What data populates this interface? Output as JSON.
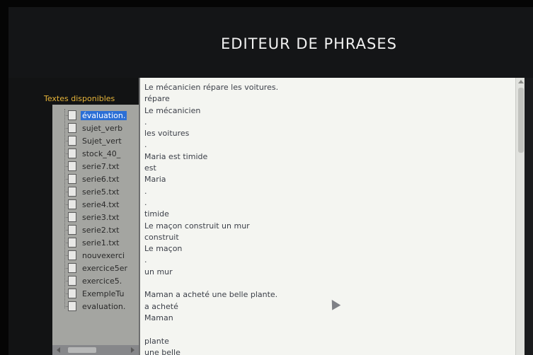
{
  "app": {
    "title": "EDITEUR DE PHRASES"
  },
  "sidebar": {
    "label": "Textes disponibles",
    "items": [
      {
        "label": "évaluation.",
        "selected": true
      },
      {
        "label": "sujet_verb"
      },
      {
        "label": "Sujet_vert"
      },
      {
        "label": "stock_40_"
      },
      {
        "label": "serie7.txt"
      },
      {
        "label": "serie6.txt"
      },
      {
        "label": "serie5.txt"
      },
      {
        "label": "serie4.txt"
      },
      {
        "label": "serie3.txt"
      },
      {
        "label": "serie2.txt"
      },
      {
        "label": "serie1.txt"
      },
      {
        "label": "nouvexerci"
      },
      {
        "label": "exercice5er"
      },
      {
        "label": "exercice5."
      },
      {
        "label": "ExempleTu"
      },
      {
        "label": "evaluation."
      }
    ]
  },
  "editor": {
    "lines": [
      "Le mécanicien répare les voitures.",
      "répare",
      "Le mécanicien",
      ".",
      "les voitures",
      ".",
      "Maria est timide",
      "est",
      "Maria",
      ".",
      ".",
      "timide",
      "Le maçon construit un mur",
      "construit",
      "Le maçon",
      ".",
      "un mur",
      "",
      "Maman a acheté une belle plante.",
      "a acheté",
      "Maman",
      "",
      "plante",
      "une belle"
    ]
  },
  "colors": {
    "label_accent": "#e6b43a",
    "selection": "#2b6fd6"
  },
  "icons": {
    "file": "document-icon",
    "cursor": "mouse-pointer-icon"
  }
}
